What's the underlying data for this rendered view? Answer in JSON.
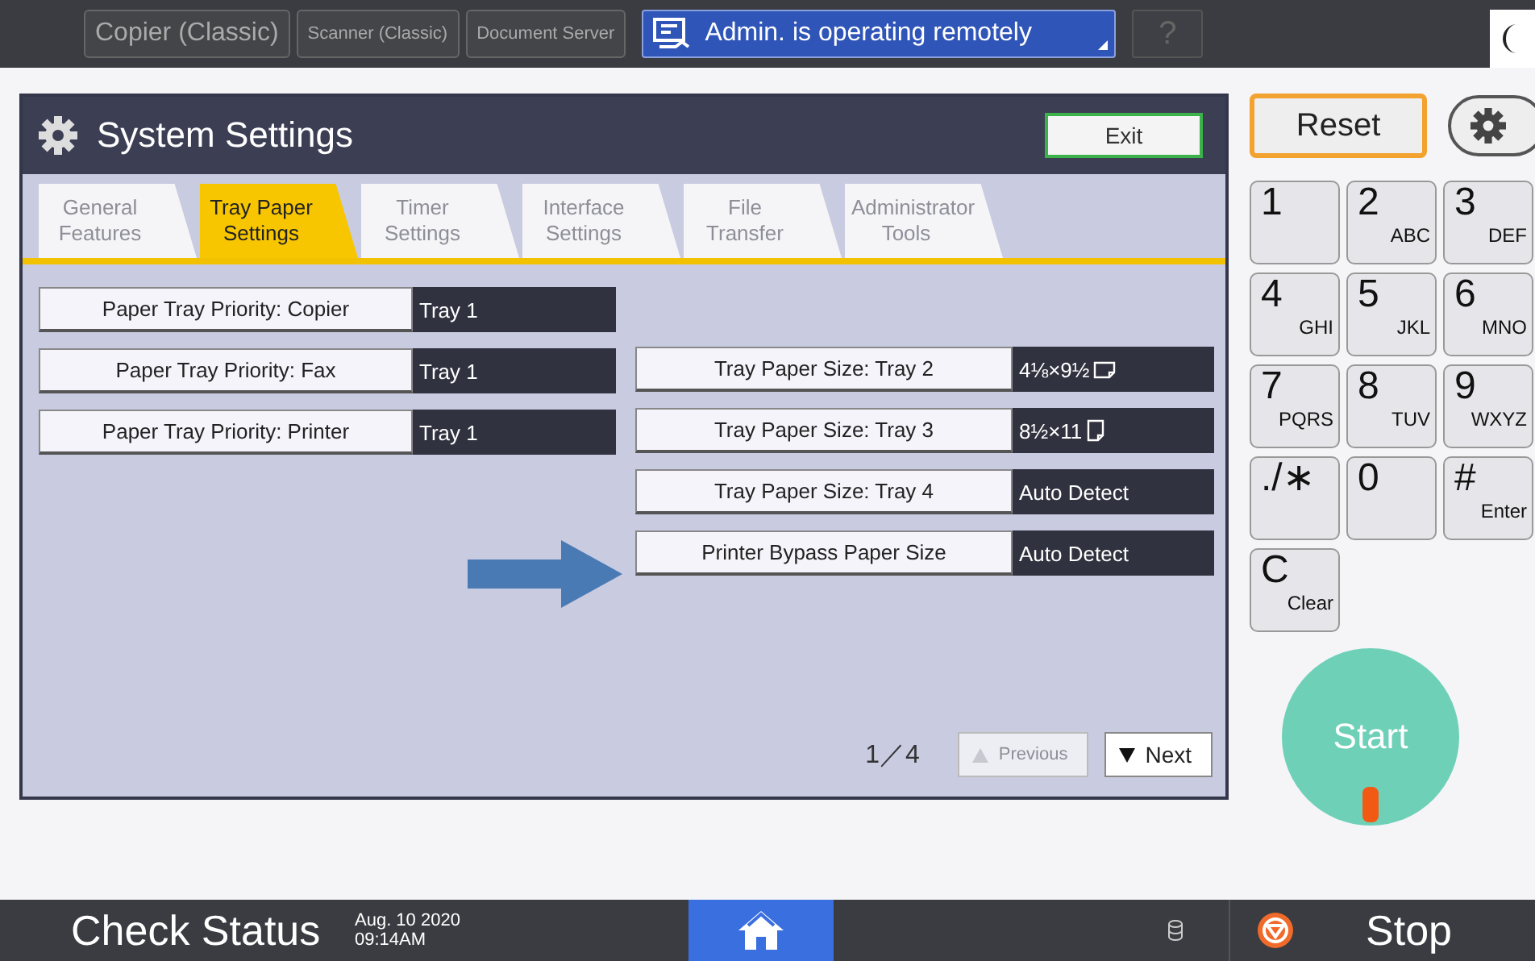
{
  "top_bar": {
    "apps": [
      {
        "label": "Copier (Classic)"
      },
      {
        "label": "Scanner (Classic)"
      },
      {
        "label": "Document Server"
      }
    ],
    "remote_status": "Admin. is operating remotely",
    "help": "?"
  },
  "window": {
    "title": "System Settings",
    "exit": "Exit"
  },
  "tabs": [
    {
      "label": "General Features",
      "selected": false,
      "disabled": true
    },
    {
      "label": "Tray Paper Settings",
      "selected": true,
      "disabled": false
    },
    {
      "label": "Timer Settings",
      "selected": false,
      "disabled": true
    },
    {
      "label": "Interface Settings",
      "selected": false,
      "disabled": true
    },
    {
      "label": "File Transfer",
      "selected": false,
      "disabled": true
    },
    {
      "label": "Administrator Tools",
      "selected": false,
      "disabled": true
    }
  ],
  "left_settings": [
    {
      "label": "Paper Tray Priority: Copier",
      "value": "Tray 1"
    },
    {
      "label": "Paper Tray Priority: Fax",
      "value": "Tray 1"
    },
    {
      "label": "Paper Tray Priority: Printer",
      "value": "Tray 1"
    }
  ],
  "right_settings": [
    {
      "label": "Tray Paper Size: Tray 2",
      "value": "4⅛×9½",
      "kind": "landscape"
    },
    {
      "label": "Tray Paper Size: Tray 3",
      "value": "8½×11",
      "kind": "portrait"
    },
    {
      "label": "Tray Paper Size: Tray 4",
      "value": "Auto Detect"
    },
    {
      "label": "Printer Bypass Paper Size",
      "value": "Auto Detect"
    }
  ],
  "pager": {
    "page": "1／4",
    "previous": {
      "label": "Previous",
      "disabled": true
    },
    "next": {
      "label": "Next",
      "disabled": false
    }
  },
  "keypad": {
    "reset": "Reset",
    "keys": [
      {
        "main": "1"
      },
      {
        "main": "2",
        "sub": "ABC"
      },
      {
        "main": "3",
        "sub": "DEF"
      },
      {
        "main": "4",
        "sub": "GHI"
      },
      {
        "main": "5",
        "sub": "JKL"
      },
      {
        "main": "6",
        "sub": "MNO"
      },
      {
        "main": "7",
        "sub": "PQRS"
      },
      {
        "main": "8",
        "sub": "TUV"
      },
      {
        "main": "9",
        "sub": "WXYZ"
      },
      {
        "main": "./∗"
      },
      {
        "main": "0"
      },
      {
        "main": "#",
        "sub": "Enter"
      },
      {
        "main": "C",
        "sub": "Clear"
      }
    ],
    "start": "Start"
  },
  "status_bar": {
    "check_status": "Check Status",
    "date": "Aug. 10 2020",
    "time": "09:14AM",
    "stop": "Stop"
  }
}
